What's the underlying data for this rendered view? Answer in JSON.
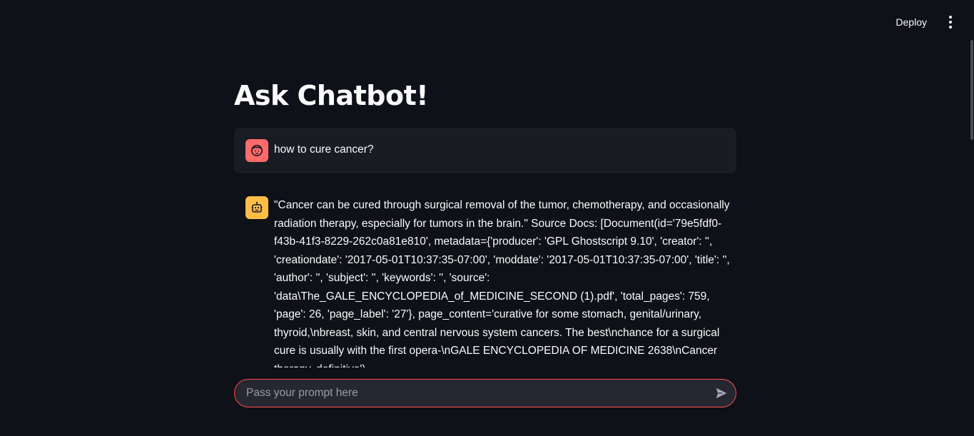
{
  "header": {
    "deploy_label": "Deploy",
    "menu_icon": "vertical-dots-icon"
  },
  "main": {
    "title": "Ask Chatbot!"
  },
  "messages": [
    {
      "role": "user",
      "avatar_icon": "user-face-icon",
      "avatar_color": "#ff6b6b",
      "text": "how to cure cancer?"
    },
    {
      "role": "assistant",
      "avatar_icon": "robot-icon",
      "avatar_color": "#ffbd45",
      "text": "\"Cancer can be cured through surgical removal of the tumor, chemotherapy, and occasionally radiation therapy, especially for tumors in the brain.\" Source Docs: [Document(id='79e5fdf0-f43b-41f3-8229-262c0a81e810', metadata={'producer': 'GPL Ghostscript 9.10', 'creator': '', 'creationdate': '2017-05-01T10:37:35-07:00', 'moddate': '2017-05-01T10:37:35-07:00', 'title': '', 'author': '', 'subject': '', 'keywords': '', 'source': 'data\\The_GALE_ENCYCLOPEDIA_of_MEDICINE_SECOND (1).pdf', 'total_pages': 759, 'page': 26, 'page_label': '27'}, page_content='curative for some stomach, genital/urinary, thyroid,\\nbreast, skin, and central nervous system cancers. The best\\nchance for a surgical cure is usually with the first opera-\\nGALE ENCYCLOPEDIA OF MEDICINE 2638\\nCancer therapy, definitive'),"
    }
  ],
  "chat_input": {
    "placeholder": "Pass your prompt here",
    "value": "",
    "send_icon": "send-icon",
    "border_color": "#ff4b4b"
  },
  "colors": {
    "background": "#0e1117",
    "user_bubble": "#1a1c24",
    "input_bg": "#262730"
  }
}
